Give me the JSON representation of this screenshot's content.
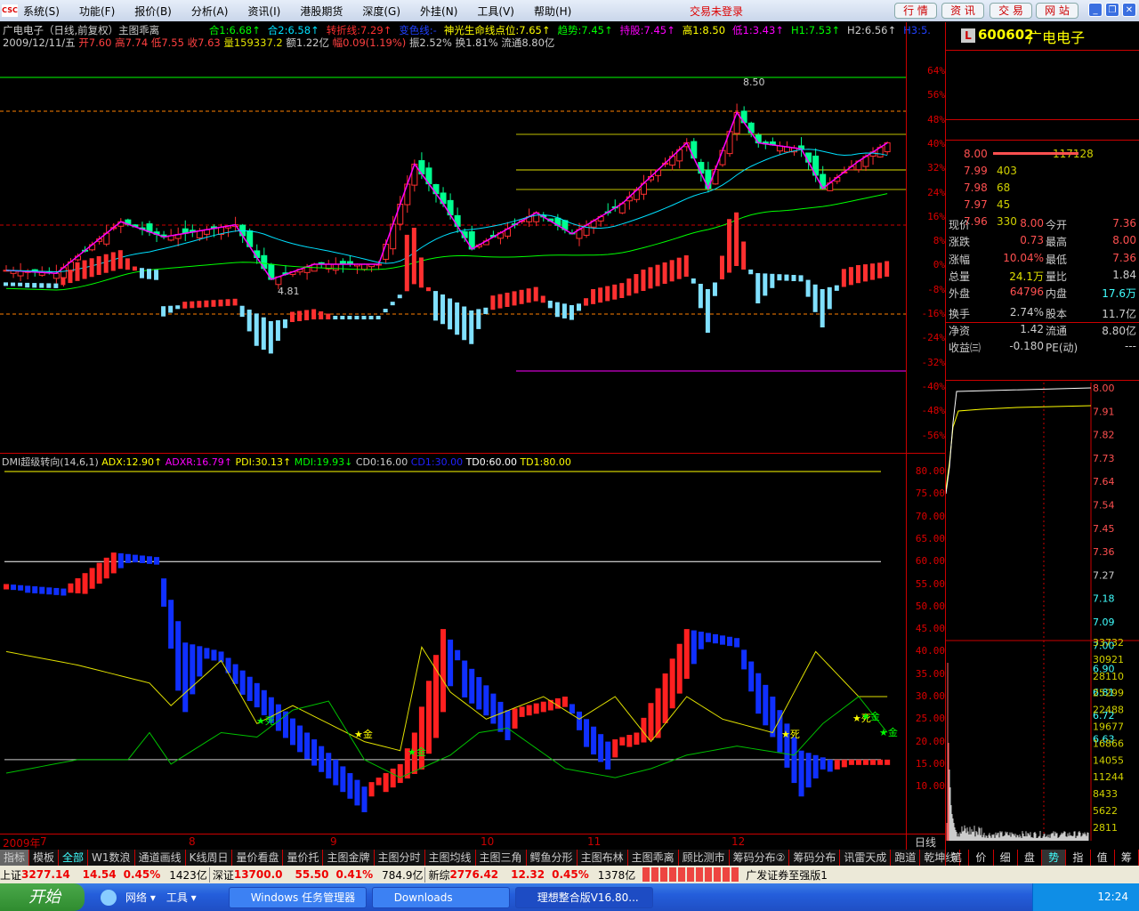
{
  "menu": {
    "items": [
      "系统(S)",
      "功能(F)",
      "报价(B)",
      "分析(A)",
      "资讯(I)",
      "港股期货",
      "深度(G)",
      "外挂(N)",
      "工具(V)",
      "帮助(H)"
    ],
    "login_status": "交易未登录",
    "buttons": [
      "行 情",
      "资 讯",
      "交 易",
      "网 站"
    ],
    "logo": "CSC"
  },
  "header": {
    "title": "广电电子（日线,前复权）主图乖离",
    "indicators": [
      {
        "t": "合1:6.68↑",
        "c": "#00ff00"
      },
      {
        "t": "合2:6.58↑",
        "c": "#00e0ff"
      },
      {
        "t": "转折线:7.29↑",
        "c": "#ff3030"
      },
      {
        "t": "变色线:-",
        "c": "#2040ff"
      },
      {
        "t": "神光生命线点位:7.65↑",
        "c": "#ffff00"
      },
      {
        "t": "趋势:7.45↑",
        "c": "#00ff00"
      },
      {
        "t": "持股:7.45↑",
        "c": "#ff00ff"
      },
      {
        "t": "高1:8.50",
        "c": "#ffff00"
      },
      {
        "t": "低1:3.43↑",
        "c": "#ff00ff"
      },
      {
        "t": "H1:7.53↑",
        "c": "#00ff00"
      },
      {
        "t": "H2:6.56↑",
        "c": "#cccccc"
      },
      {
        "t": "H3:5.",
        "c": "#2040ff"
      }
    ],
    "quote": [
      {
        "t": "2009/12/11/五 ",
        "c": "#ccc"
      },
      {
        "t": "开7.60 高7.74 低7.55 收7.63 ",
        "c": "#ff4040"
      },
      {
        "t": "量159337.2 ",
        "c": "#e0e000"
      },
      {
        "t": "额1.22亿 ",
        "c": "#ccc"
      },
      {
        "t": "幅0.09(1.19%) ",
        "c": "#ff4040"
      },
      {
        "t": "振2.52% 换1.81% 流通8.80亿",
        "c": "#ccc"
      }
    ]
  },
  "main_axis": [
    "64%",
    "56%",
    "48%",
    "40%",
    "32%",
    "24%",
    "16%",
    "8%",
    "0%",
    "-8%",
    "-16%",
    "-24%",
    "-32%",
    "-40%",
    "-48%",
    "-56%"
  ],
  "annotations": {
    "high": "8.50",
    "low": "4.81"
  },
  "dmi": {
    "header": [
      {
        "t": "DMI超级转向(14,6,1) ",
        "c": "#ccc"
      },
      {
        "t": "ADX:12.90↑ ",
        "c": "#ffff00"
      },
      {
        "t": "ADXR:16.79↑ ",
        "c": "#ff00ff"
      },
      {
        "t": "PDI:30.13↑ ",
        "c": "#ffff00"
      },
      {
        "t": "MDI:19.93↓ ",
        "c": "#00ff00"
      },
      {
        "t": "CD0:16.00 ",
        "c": "#ccc"
      },
      {
        "t": "CD1:30.00 ",
        "c": "#2020ff"
      },
      {
        "t": "TD0:60.00 ",
        "c": "#fff"
      },
      {
        "t": "TD1:80.00",
        "c": "#ffff00"
      }
    ],
    "axis": [
      "80.00",
      "75.00",
      "70.00",
      "65.00",
      "60.00",
      "55.00",
      "50.00",
      "45.00",
      "40.00",
      "35.00",
      "30.00",
      "25.00",
      "20.00",
      "15.00",
      "10.00"
    ],
    "signals": [
      "死",
      "金",
      "金",
      "死",
      "金",
      "死",
      "金"
    ]
  },
  "date_axis": {
    "labels": [
      "2009年",
      "7",
      "8",
      "9",
      "10",
      "11",
      "12"
    ],
    "period": "日线"
  },
  "tabs": [
    "指标",
    "模板",
    "全部",
    "W1数浪",
    "通道画线",
    "K线周日",
    "量价看盘",
    "量价托",
    "主图金牌",
    "主图分时",
    "主图均线",
    "主图三角",
    "鳄鱼分形",
    "主图布林",
    "主图乖离",
    "顾比测市",
    "筹码分布②",
    "筹码分布",
    "讯雷天成",
    "跑道",
    "乾坤线"
  ],
  "right_tabs": [
    "笔",
    "价",
    "细",
    "盘",
    "势",
    "指",
    "值",
    "筹"
  ],
  "stock": {
    "badge": "L",
    "code": "600602",
    "name": "广电电子"
  },
  "orderbook": [
    {
      "p": "8.00",
      "v": "117128"
    },
    {
      "p": "7.99",
      "v": "403"
    },
    {
      "p": "7.98",
      "v": "68"
    },
    {
      "p": "7.97",
      "v": "45"
    },
    {
      "p": "7.96",
      "v": "330"
    }
  ],
  "stats": [
    [
      {
        "l": "现价",
        "v": "8.00",
        "c": "#ff5050"
      },
      {
        "l": "今开",
        "v": "7.36",
        "c": "#ff5050"
      }
    ],
    [
      {
        "l": "涨跌",
        "v": "0.73",
        "c": "#ff5050"
      },
      {
        "l": "最高",
        "v": "8.00",
        "c": "#ff5050"
      }
    ],
    [
      {
        "l": "涨幅",
        "v": "10.04%",
        "c": "#ff5050"
      },
      {
        "l": "最低",
        "v": "7.36",
        "c": "#ff5050"
      }
    ],
    [
      {
        "l": "总量",
        "v": "24.1万",
        "c": "#e0e000"
      },
      {
        "l": "量比",
        "v": "1.84",
        "c": "#ccc"
      }
    ],
    [
      {
        "l": "外盘",
        "v": "64796",
        "c": "#ff5050"
      },
      {
        "l": "内盘",
        "v": "17.6万",
        "c": "#40ffff"
      }
    ],
    [
      {
        "l": "换手",
        "v": "2.74%",
        "c": "#ccc"
      },
      {
        "l": "股本",
        "v": "11.7亿",
        "c": "#ccc"
      }
    ],
    [
      {
        "l": "净资",
        "v": "1.42",
        "c": "#ccc"
      },
      {
        "l": "流通",
        "v": "8.80亿",
        "c": "#ccc"
      }
    ],
    [
      {
        "l": "收益㈢",
        "v": "-0.180",
        "c": "#ccc"
      },
      {
        "l": "PE(动)",
        "v": "---",
        "c": "#ccc"
      }
    ]
  ],
  "intraday_price_axis": [
    "8.00",
    "7.91",
    "7.82",
    "7.73",
    "7.64",
    "7.54",
    "7.45",
    "7.36",
    "7.27",
    "7.18",
    "7.09",
    "7.00",
    "6.90",
    "6.81",
    "6.72",
    "6.63"
  ],
  "intraday_vol_axis": [
    "33732",
    "30921",
    "28110",
    "25299",
    "22488",
    "19677",
    "16866",
    "14055",
    "11244",
    "8433",
    "5622",
    "2811"
  ],
  "status": {
    "sh_label": "上证",
    "sh": "3277.14",
    "sh_chg": "14.54",
    "sh_pct": "0.45%",
    "sh_amt": "1423亿",
    "sz_label": "深证",
    "sz": "13700.0",
    "sz_chg": "55.50",
    "sz_pct": "0.41%",
    "sz_amt": "784.9亿",
    "xz_label": "新综",
    "xz": "2776.42",
    "xz_chg": "12.32",
    "xz_pct": "0.45%",
    "xz_amt": "1378亿",
    "broker": "广发证券至强版1"
  },
  "taskbar": {
    "start": "开始",
    "quick": [
      "网络 ▾",
      "工具 ▾"
    ],
    "tasks": [
      "Windows 任务管理器",
      "Downloads",
      "理想整合版V16.80..."
    ],
    "clock": "12:24"
  },
  "chart_data": {
    "type": "candlestick",
    "price_pct_keypoints": [
      [
        0,
        -2
      ],
      [
        7,
        -3
      ],
      [
        16,
        14
      ],
      [
        22,
        9
      ],
      [
        32,
        13
      ],
      [
        37,
        -5
      ],
      [
        43,
        0
      ],
      [
        52,
        0
      ],
      [
        57,
        33
      ],
      [
        61,
        20
      ],
      [
        65,
        5
      ],
      [
        74,
        17
      ],
      [
        79,
        10
      ],
      [
        86,
        20
      ],
      [
        95,
        40
      ],
      [
        98,
        25
      ],
      [
        102,
        50
      ],
      [
        105,
        40
      ],
      [
        111,
        38
      ],
      [
        114,
        25
      ],
      [
        119,
        34
      ],
      [
        123,
        40
      ]
    ],
    "adx_keypoints": [
      [
        0,
        55
      ],
      [
        8,
        54
      ],
      [
        15,
        62
      ],
      [
        21,
        61
      ],
      [
        25,
        42
      ],
      [
        30,
        40
      ],
      [
        35,
        33
      ],
      [
        42,
        22
      ],
      [
        50,
        10
      ],
      [
        55,
        15
      ],
      [
        57,
        22
      ],
      [
        61,
        45
      ],
      [
        64,
        38
      ],
      [
        70,
        27
      ],
      [
        78,
        30
      ],
      [
        84,
        20
      ],
      [
        88,
        22
      ],
      [
        95,
        45
      ],
      [
        102,
        43
      ],
      [
        107,
        30
      ],
      [
        111,
        18
      ],
      [
        115,
        16
      ],
      [
        124,
        16
      ]
    ],
    "pdi_keypoints": [
      [
        0,
        40
      ],
      [
        10,
        37
      ],
      [
        20,
        33
      ],
      [
        23,
        28
      ],
      [
        30,
        38
      ],
      [
        35,
        24
      ],
      [
        40,
        28
      ],
      [
        50,
        20
      ],
      [
        55,
        18
      ],
      [
        58,
        41
      ],
      [
        62,
        31
      ],
      [
        67,
        25
      ],
      [
        75,
        30
      ],
      [
        80,
        25
      ],
      [
        85,
        30
      ],
      [
        90,
        20
      ],
      [
        95,
        30
      ],
      [
        100,
        25
      ],
      [
        107,
        22
      ],
      [
        113,
        40
      ],
      [
        119,
        30
      ],
      [
        123,
        30
      ]
    ],
    "mdi_keypoints": [
      [
        0,
        13
      ],
      [
        10,
        16
      ],
      [
        17,
        16
      ],
      [
        20,
        22
      ],
      [
        23,
        15
      ],
      [
        30,
        22
      ],
      [
        35,
        21
      ],
      [
        40,
        27
      ],
      [
        45,
        29
      ],
      [
        50,
        16
      ],
      [
        55,
        12
      ],
      [
        62,
        17
      ],
      [
        66,
        22
      ],
      [
        70,
        23
      ],
      [
        78,
        14
      ],
      [
        85,
        12
      ],
      [
        90,
        14
      ],
      [
        95,
        17
      ],
      [
        102,
        19
      ],
      [
        110,
        17
      ],
      [
        114,
        24
      ],
      [
        119,
        30
      ],
      [
        123,
        22
      ]
    ]
  }
}
